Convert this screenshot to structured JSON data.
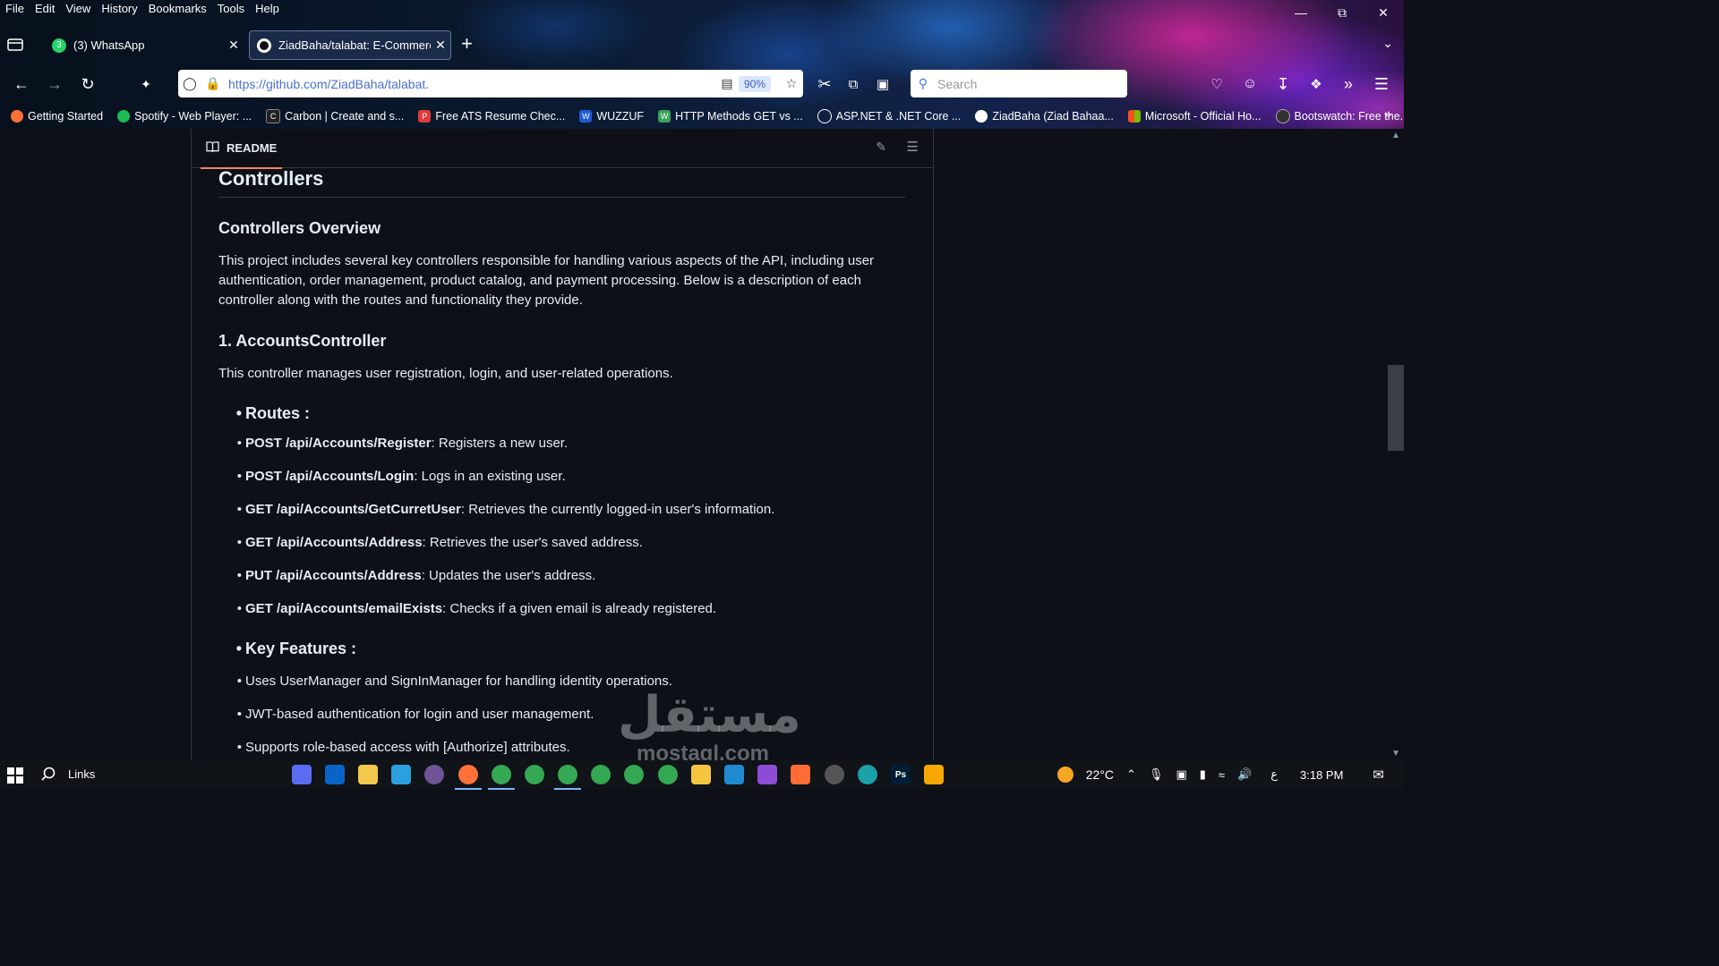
{
  "menubar": [
    "File",
    "Edit",
    "View",
    "History",
    "Bookmarks",
    "Tools",
    "Help"
  ],
  "tabs": [
    {
      "title": "(3) WhatsApp",
      "badge": "3",
      "favicon": "whatsapp-icon",
      "color": "#25d366"
    },
    {
      "title": "ZiadBaha/talabat: E-Commerce",
      "favicon": "github-icon",
      "color": "#ffffff"
    }
  ],
  "urlbar": {
    "url": "https://github.com/ZiadBaha/talabat.",
    "zoom": "90%"
  },
  "searchbar": {
    "placeholder": "Search"
  },
  "bookmarks": [
    {
      "label": "Getting Started",
      "icon": "firefox-icon",
      "color": "#ff7139"
    },
    {
      "label": "Spotify - Web Player: ...",
      "icon": "spotify-icon",
      "color": "#1db954"
    },
    {
      "label": "Carbon | Create and s...",
      "icon": "carbon-icon",
      "color": "#222222"
    },
    {
      "label": "Free ATS Resume Chec...",
      "icon": "ats-icon",
      "color": "#e03a3a"
    },
    {
      "label": "WUZZUF",
      "icon": "wuzzuf-icon",
      "color": "#1f5ad6"
    },
    {
      "label": "HTTP Methods GET vs ...",
      "icon": "http-icon",
      "color": "#3aa35a"
    },
    {
      "label": "ASP.NET & .NET Core ...",
      "icon": "globe-icon",
      "color": "#7a8aa0"
    },
    {
      "label": "ZiadBaha (Ziad Bahaa...",
      "icon": "github-icon",
      "color": "#ffffff"
    },
    {
      "label": "Microsoft - Official Ho...",
      "icon": "microsoft-icon",
      "color": "#f25022"
    },
    {
      "label": "Bootswatch: Free the...",
      "icon": "bootswatch-icon",
      "color": "#333333"
    }
  ],
  "readme": {
    "tab_label": "README",
    "section_title": "Controllers",
    "overview_title": "Controllers Overview",
    "overview_text": "This project includes several key controllers responsible for handling various aspects of the API, including user authentication, order management, product catalog, and payment processing. Below is a description of each controller along with the routes and functionality they provide.",
    "accounts_title": "1. AccountsController",
    "accounts_text": "This controller manages user registration, login, and user-related operations.",
    "routes_title": "Routes :",
    "routes": [
      {
        "route": "POST /api/Accounts/Register",
        "desc": ": Registers a new user."
      },
      {
        "route": "POST /api/Accounts/Login",
        "desc": ": Logs in an existing user."
      },
      {
        "route": "GET /api/Accounts/GetCurretUser",
        "desc": ": Retrieves the currently logged-in user's information."
      },
      {
        "route": "GET /api/Accounts/Address",
        "desc": ": Retrieves the user's saved address."
      },
      {
        "route": "PUT /api/Accounts/Address",
        "desc": ": Updates the user's address."
      },
      {
        "route": "GET /api/Accounts/emailExists",
        "desc": ": Checks if a given email is already registered."
      }
    ],
    "features_title": "Key Features :",
    "features": [
      "Uses UserManager and SignInManager for handling identity operations.",
      "JWT-based authentication for login and user management.",
      "Supports role-based access with [Authorize] attributes."
    ]
  },
  "watermark": {
    "arabic": "مستقل",
    "latin": "mostaql.com"
  },
  "taskbar": {
    "links_label": "Links",
    "apps": [
      {
        "name": "copilot-icon",
        "color": "#5b6cf0"
      },
      {
        "name": "outlook-icon",
        "color": "#0a64c8"
      },
      {
        "name": "file-explorer-icon",
        "color": "#f2c94c"
      },
      {
        "name": "telegram-icon",
        "color": "#2aa1de"
      },
      {
        "name": "github-desktop-icon",
        "color": "#6e5494"
      },
      {
        "name": "firefox-icon",
        "color": "#ff7139",
        "active": true
      },
      {
        "name": "chrome-icon",
        "color": "#34a853",
        "active": true
      },
      {
        "name": "chrome-icon",
        "color": "#34a853"
      },
      {
        "name": "chrome-icon",
        "color": "#34a853",
        "active": true
      },
      {
        "name": "chrome-icon",
        "color": "#34a853"
      },
      {
        "name": "chrome-icon",
        "color": "#34a853"
      },
      {
        "name": "chrome-icon",
        "color": "#34a853"
      },
      {
        "name": "sticky-notes-icon",
        "color": "#f5c542"
      },
      {
        "name": "vscode-icon",
        "color": "#1f8ad2"
      },
      {
        "name": "visual-studio-icon",
        "color": "#8e4bd6"
      },
      {
        "name": "postman-icon",
        "color": "#ff6c37"
      },
      {
        "name": "media-player-icon",
        "color": "#555555"
      },
      {
        "name": "edge-icon",
        "color": "#1ba1a8"
      },
      {
        "name": "photoshop-icon",
        "color": "#001e36",
        "label": "Ps"
      },
      {
        "name": "aws-icon",
        "color": "#f7a800"
      }
    ],
    "temperature": "22°C",
    "ime": "ع",
    "time": "3:18 PM"
  }
}
